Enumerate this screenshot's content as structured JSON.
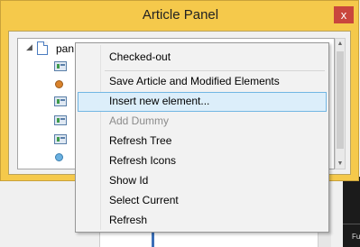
{
  "window": {
    "title": "Article Panel",
    "close_symbol": "x"
  },
  "tree": {
    "root_label": "pan"
  },
  "context_menu": {
    "items": [
      {
        "label": "Checked-out",
        "enabled": true
      },
      {
        "label": "Save Article and Modified Elements",
        "enabled": true
      },
      {
        "label": "Insert new element...",
        "enabled": true,
        "highlighted": true
      },
      {
        "label": "Add Dummy",
        "enabled": false
      },
      {
        "label": "Refresh Tree",
        "enabled": true
      },
      {
        "label": "Refresh Icons",
        "enabled": true
      },
      {
        "label": "Show Id",
        "enabled": true
      },
      {
        "label": "Select Current",
        "enabled": true
      },
      {
        "label": "Refresh",
        "enabled": true
      }
    ]
  },
  "background": {
    "partial_text": "Fu"
  },
  "colors": {
    "title_bar": "#f5c94b",
    "close_button": "#c9463d",
    "menu_highlight": "#dceefa",
    "menu_highlight_border": "#72b6e3"
  }
}
